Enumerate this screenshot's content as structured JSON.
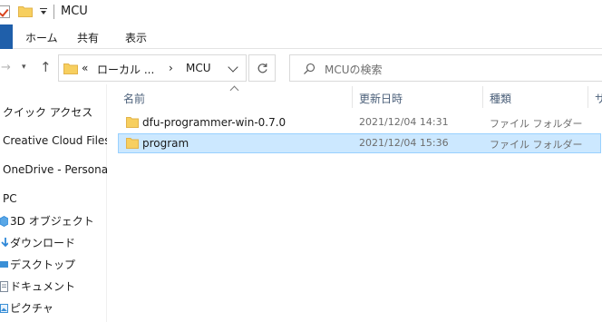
{
  "window": {
    "title": "MCU"
  },
  "ribbon": {
    "tabs": [
      "ホーム",
      "共有",
      "表示"
    ]
  },
  "address": {
    "overflow": "«",
    "crumbs": [
      "ローカル ...",
      "MCU"
    ],
    "separator": "›"
  },
  "search": {
    "placeholder": "MCUの検索"
  },
  "nav": {
    "items": [
      {
        "label": "クイック アクセス",
        "icon": "star-icon"
      },
      {
        "label": "Creative Cloud Files",
        "icon": "creative-cloud-icon"
      },
      {
        "label": "OneDrive - Personal",
        "icon": "onedrive-icon"
      },
      {
        "label": "PC",
        "icon": "pc-icon"
      }
    ],
    "pc_children": [
      {
        "label": "3D オブジェクト",
        "icon": "3d-objects-icon",
        "color": "#2f88d8"
      },
      {
        "label": "ダウンロード",
        "icon": "download-icon",
        "color": "#2f88d8"
      },
      {
        "label": "デスクトップ",
        "icon": "desktop-icon",
        "color": "#2f88d8"
      },
      {
        "label": "ドキュメント",
        "icon": "documents-icon",
        "color": "#7d8a9a"
      },
      {
        "label": "ピクチャ",
        "icon": "pictures-icon",
        "color": "#3a8fd6"
      }
    ]
  },
  "columns": {
    "name": "名前",
    "modified": "更新日時",
    "type": "種類",
    "size": "サ"
  },
  "files": [
    {
      "name": "dfu-programmer-win-0.7.0",
      "modified": "2021/12/04 14:31",
      "type": "ファイル フォルダー",
      "selected": false
    },
    {
      "name": "program",
      "modified": "2021/12/04 15:36",
      "type": "ファイル フォルダー",
      "selected": true
    }
  ],
  "colors": {
    "folder": "#f7cf5f",
    "folder_edge": "#e2b34a",
    "selection_bg": "#cce8ff",
    "selection_border": "#99d1ff",
    "ribbon_file": "#1f5faa",
    "header_text": "#4c607a"
  }
}
